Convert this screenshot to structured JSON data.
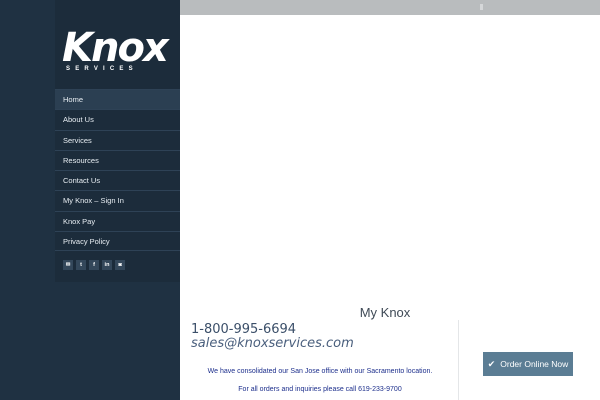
{
  "logo": {
    "word": "Knox",
    "subtitle": "SERVICES"
  },
  "nav": {
    "items": [
      {
        "label": "Home"
      },
      {
        "label": "About Us"
      },
      {
        "label": "Services"
      },
      {
        "label": "Resources"
      },
      {
        "label": "Contact Us"
      },
      {
        "label": "My Knox – Sign In"
      },
      {
        "label": "Knox Pay"
      },
      {
        "label": "Privacy Policy"
      }
    ],
    "active": "Home"
  },
  "social": {
    "icons": [
      "mail-icon",
      "twitter-icon",
      "facebook-icon",
      "linkedin-icon",
      "instagram-icon"
    ]
  },
  "main": {
    "title": "My Knox",
    "phone": "1-800-995-6694",
    "email": "sales@knoxservices.com",
    "notice_line1": "We have consolidated our San Jose office with our Sacramento location.",
    "notice_line2": "For all orders and inquiries please call 619-233-9700",
    "order_button": "Order Online Now"
  },
  "colors": {
    "sidebar": "#1c2c3b",
    "order_button": "#5b7d94",
    "notice_text": "#1d2f8c"
  }
}
